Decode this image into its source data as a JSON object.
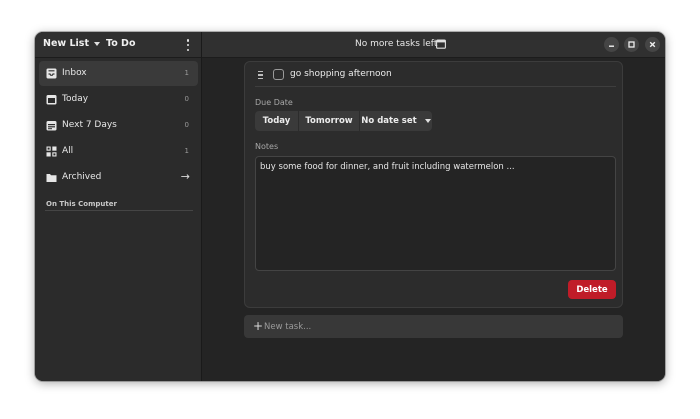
{
  "sidebar": {
    "new_list_label": "New List",
    "project_title": "To Do",
    "items": [
      {
        "label": "Inbox",
        "count": "1",
        "icon": "inbox-icon"
      },
      {
        "label": "Today",
        "count": "0",
        "icon": "calendar-today-icon"
      },
      {
        "label": "Next 7 Days",
        "count": "0",
        "icon": "calendar-week-icon"
      },
      {
        "label": "All",
        "count": "1",
        "icon": "grid-icon"
      },
      {
        "label": "Archived",
        "icon": "folder-icon"
      }
    ],
    "section_label": "On This Computer"
  },
  "header": {
    "title": "No more tasks left"
  },
  "task": {
    "title": "go shopping afternoon",
    "due_date_label": "Due Date",
    "date_buttons": {
      "today": "Today",
      "tomorrow": "Tomorrow",
      "no_date": "No date set"
    },
    "notes_label": "Notes",
    "notes": "buy some food for dinner, and fruit including watermelon ...",
    "delete_label": "Delete"
  },
  "new_task": {
    "placeholder": "New task..."
  },
  "colors": {
    "destructive": "#c01c28",
    "window_bg": "#242424",
    "sidebar_bg": "#2b2b2b"
  }
}
